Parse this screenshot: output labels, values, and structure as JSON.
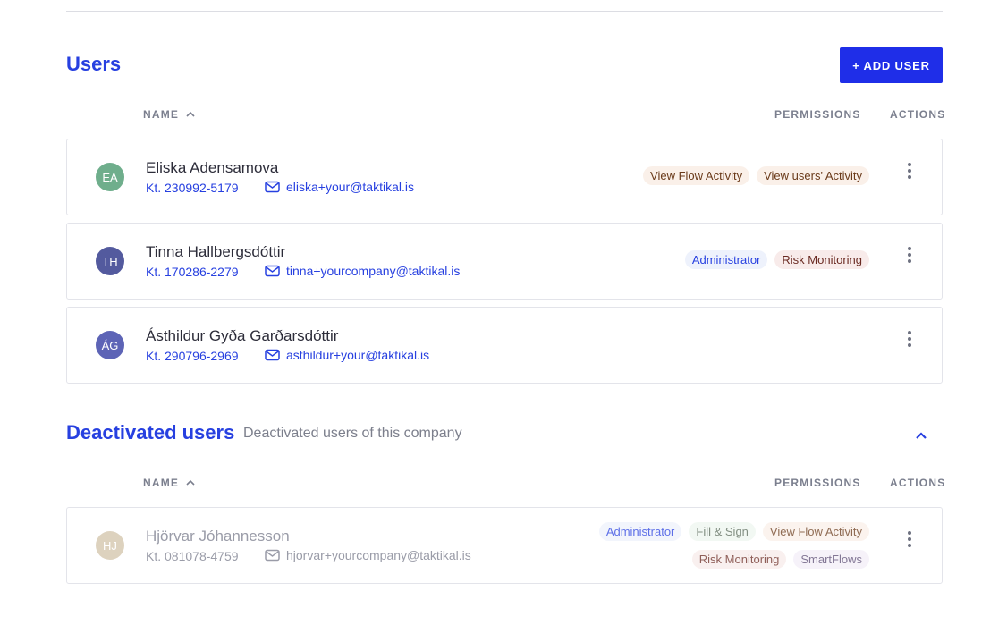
{
  "users_section": {
    "title": "Users",
    "add_button": "+ ADD USER",
    "columns": {
      "name": "NAME",
      "permissions": "PERMISSIONS",
      "actions": "ACTIONS"
    },
    "users": [
      {
        "initials": "EA",
        "avatar_color": "#6fae8c",
        "name": "Eliska Adensamova",
        "kt": "Kt. 230992-5179",
        "email": "eliska+your@taktikal.is",
        "permissions": [
          {
            "label": "View Flow Activity",
            "tone": "brown"
          },
          {
            "label": "View users' Activity",
            "tone": "brown"
          }
        ]
      },
      {
        "initials": "TH",
        "avatar_color": "#535a9e",
        "name": "Tinna Hallbergsdóttir",
        "kt": "Kt. 170286-2279",
        "email": "tinna+yourcompany@taktikal.is",
        "permissions": [
          {
            "label": "Administrator",
            "tone": "blue"
          },
          {
            "label": "Risk Monitoring",
            "tone": "red"
          }
        ]
      },
      {
        "initials": "ÁG",
        "avatar_color": "#5d64b6",
        "name": "Ásthildur Gyða Garðarsdóttir",
        "kt": "Kt. 290796-2969",
        "email": "asthildur+your@taktikal.is",
        "permissions": []
      }
    ]
  },
  "deactivated_section": {
    "title": "Deactivated users",
    "subtitle": "Deactivated users of this company",
    "columns": {
      "name": "NAME",
      "permissions": "PERMISSIONS",
      "actions": "ACTIONS"
    },
    "users": [
      {
        "initials": "HJ",
        "avatar_color": "#c2ae8a",
        "name": "Hjörvar Jóhannesson",
        "kt": "Kt. 081078-4759",
        "email": "hjorvar+yourcompany@taktikal.is",
        "permissions": [
          {
            "label": "Administrator",
            "tone": "blue"
          },
          {
            "label": "Fill & Sign",
            "tone": "green"
          },
          {
            "label": "View Flow Activity",
            "tone": "brown"
          },
          {
            "label": "Risk Monitoring",
            "tone": "red"
          },
          {
            "label": "SmartFlows",
            "tone": "purple"
          }
        ]
      }
    ]
  },
  "colors": {
    "accent": "#2740e0",
    "button": "#1f2ee8"
  }
}
